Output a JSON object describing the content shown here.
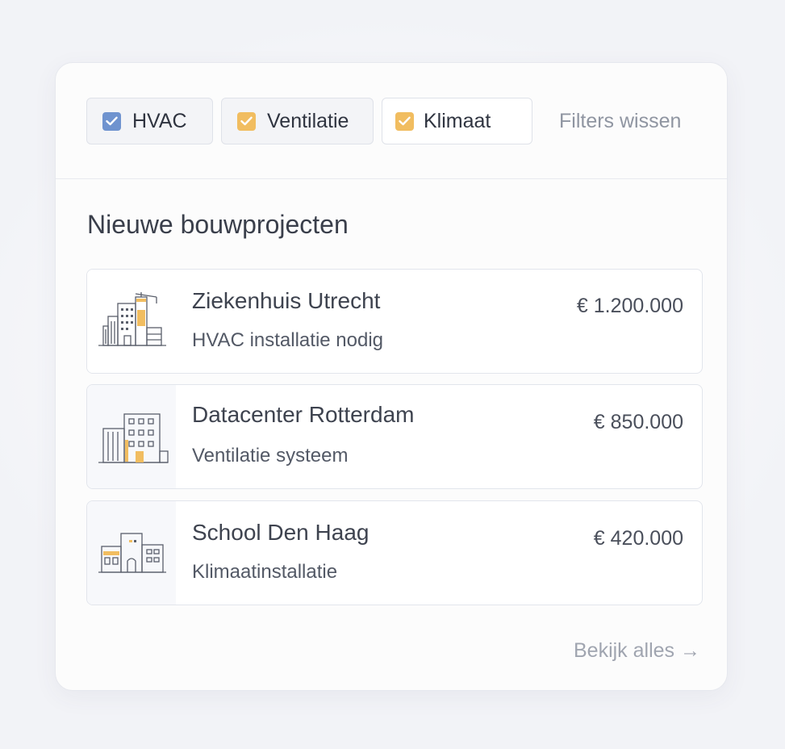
{
  "filters": {
    "chips": [
      {
        "label": "HVAC",
        "checked": true,
        "color": "#6f93cf"
      },
      {
        "label": "Ventilatie",
        "checked": true,
        "color": "#f1bd60"
      },
      {
        "label": "Klimaat",
        "checked": true,
        "color": "#f1bd60"
      }
    ],
    "clear_label": "Filters wissen"
  },
  "section": {
    "title": "Nieuwe bouwprojecten"
  },
  "projects": [
    {
      "name": "Ziekenhuis Utrecht",
      "subtitle": "HVAC installatie nodig",
      "price": "€ 1.200.000",
      "icon": "hospital-building-icon"
    },
    {
      "name": "Datacenter Rotterdam",
      "subtitle": "Ventilatie systeem",
      "price": "€ 850.000",
      "icon": "datacenter-building-icon"
    },
    {
      "name": "School Den Haag",
      "subtitle": "Klimaatinstallatie",
      "price": "€ 420.000",
      "icon": "school-building-icon"
    }
  ],
  "footer": {
    "view_all_label": "Bekijk alles →"
  },
  "colors": {
    "accent_blue": "#6f93cf",
    "accent_yellow": "#f1bd60",
    "text_primary": "#3e434f",
    "text_muted": "#8f95a1"
  }
}
